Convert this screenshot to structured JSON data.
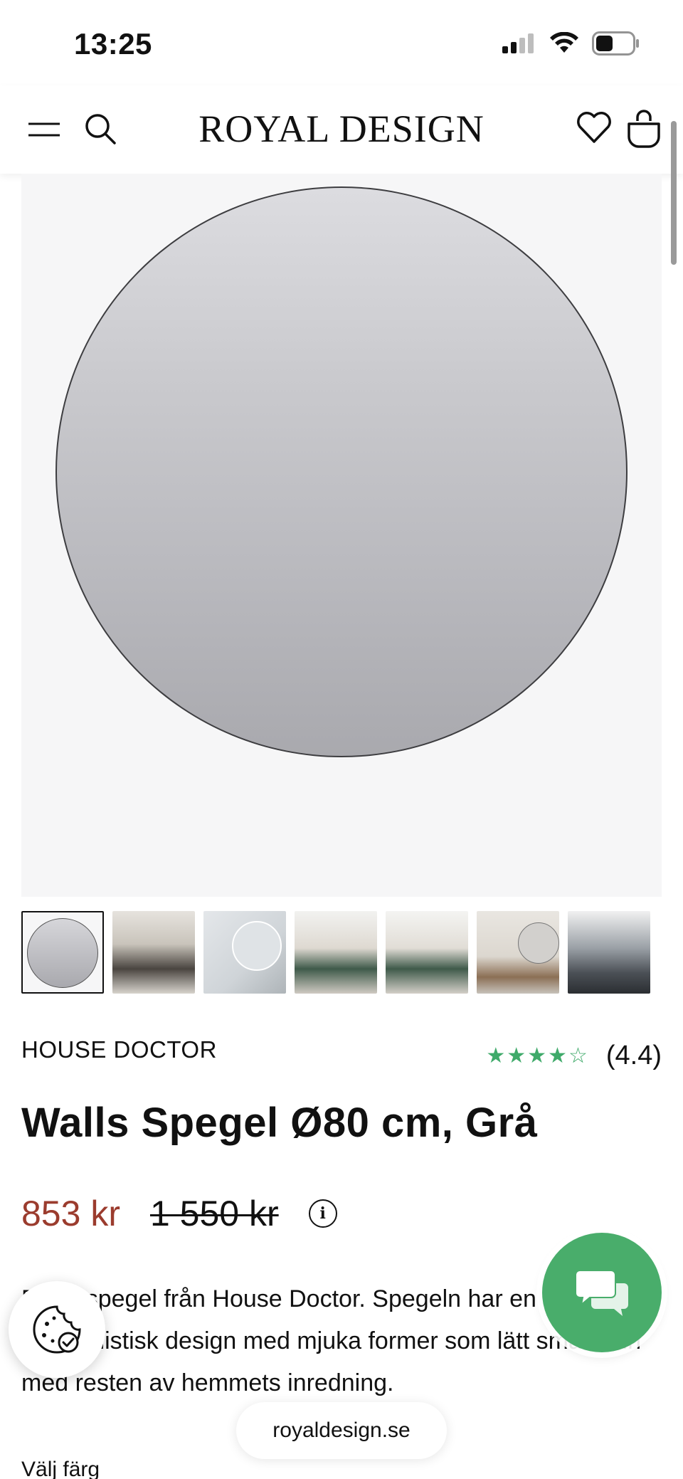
{
  "status_bar": {
    "time": "13:25",
    "icons": [
      "cellular-signal-icon",
      "wifi-icon",
      "battery-icon"
    ],
    "battery_level": 0.45
  },
  "header": {
    "logo": "ROYAL DESIGN",
    "icons": [
      "menu-icon",
      "search-icon",
      "heart-icon",
      "shopping-bag-icon"
    ]
  },
  "gallery": {
    "thumbnail_count": 7,
    "selected_index": 0
  },
  "product": {
    "brand": "HOUSE DOCTOR",
    "rating_stars": 4.4,
    "rating_label": "(4.4)",
    "stars_display": "★★★★☆",
    "title": "Walls Spegel Ø80 cm, Grå",
    "price_current": "853 kr",
    "price_original": "1 550 kr",
    "description": "Rund spegel från House Doctor. Spegeln har en minimalistisk design med mjuka former som lätt smälter in med resten av hemmets inredning.",
    "choose_color_label": "Välj färg"
  },
  "browser": {
    "url": "royaldesign.se"
  },
  "colors": {
    "sale_price": "#9b3c2e",
    "rating_star": "#3faa6a",
    "chat_button": "#49ad6b"
  }
}
